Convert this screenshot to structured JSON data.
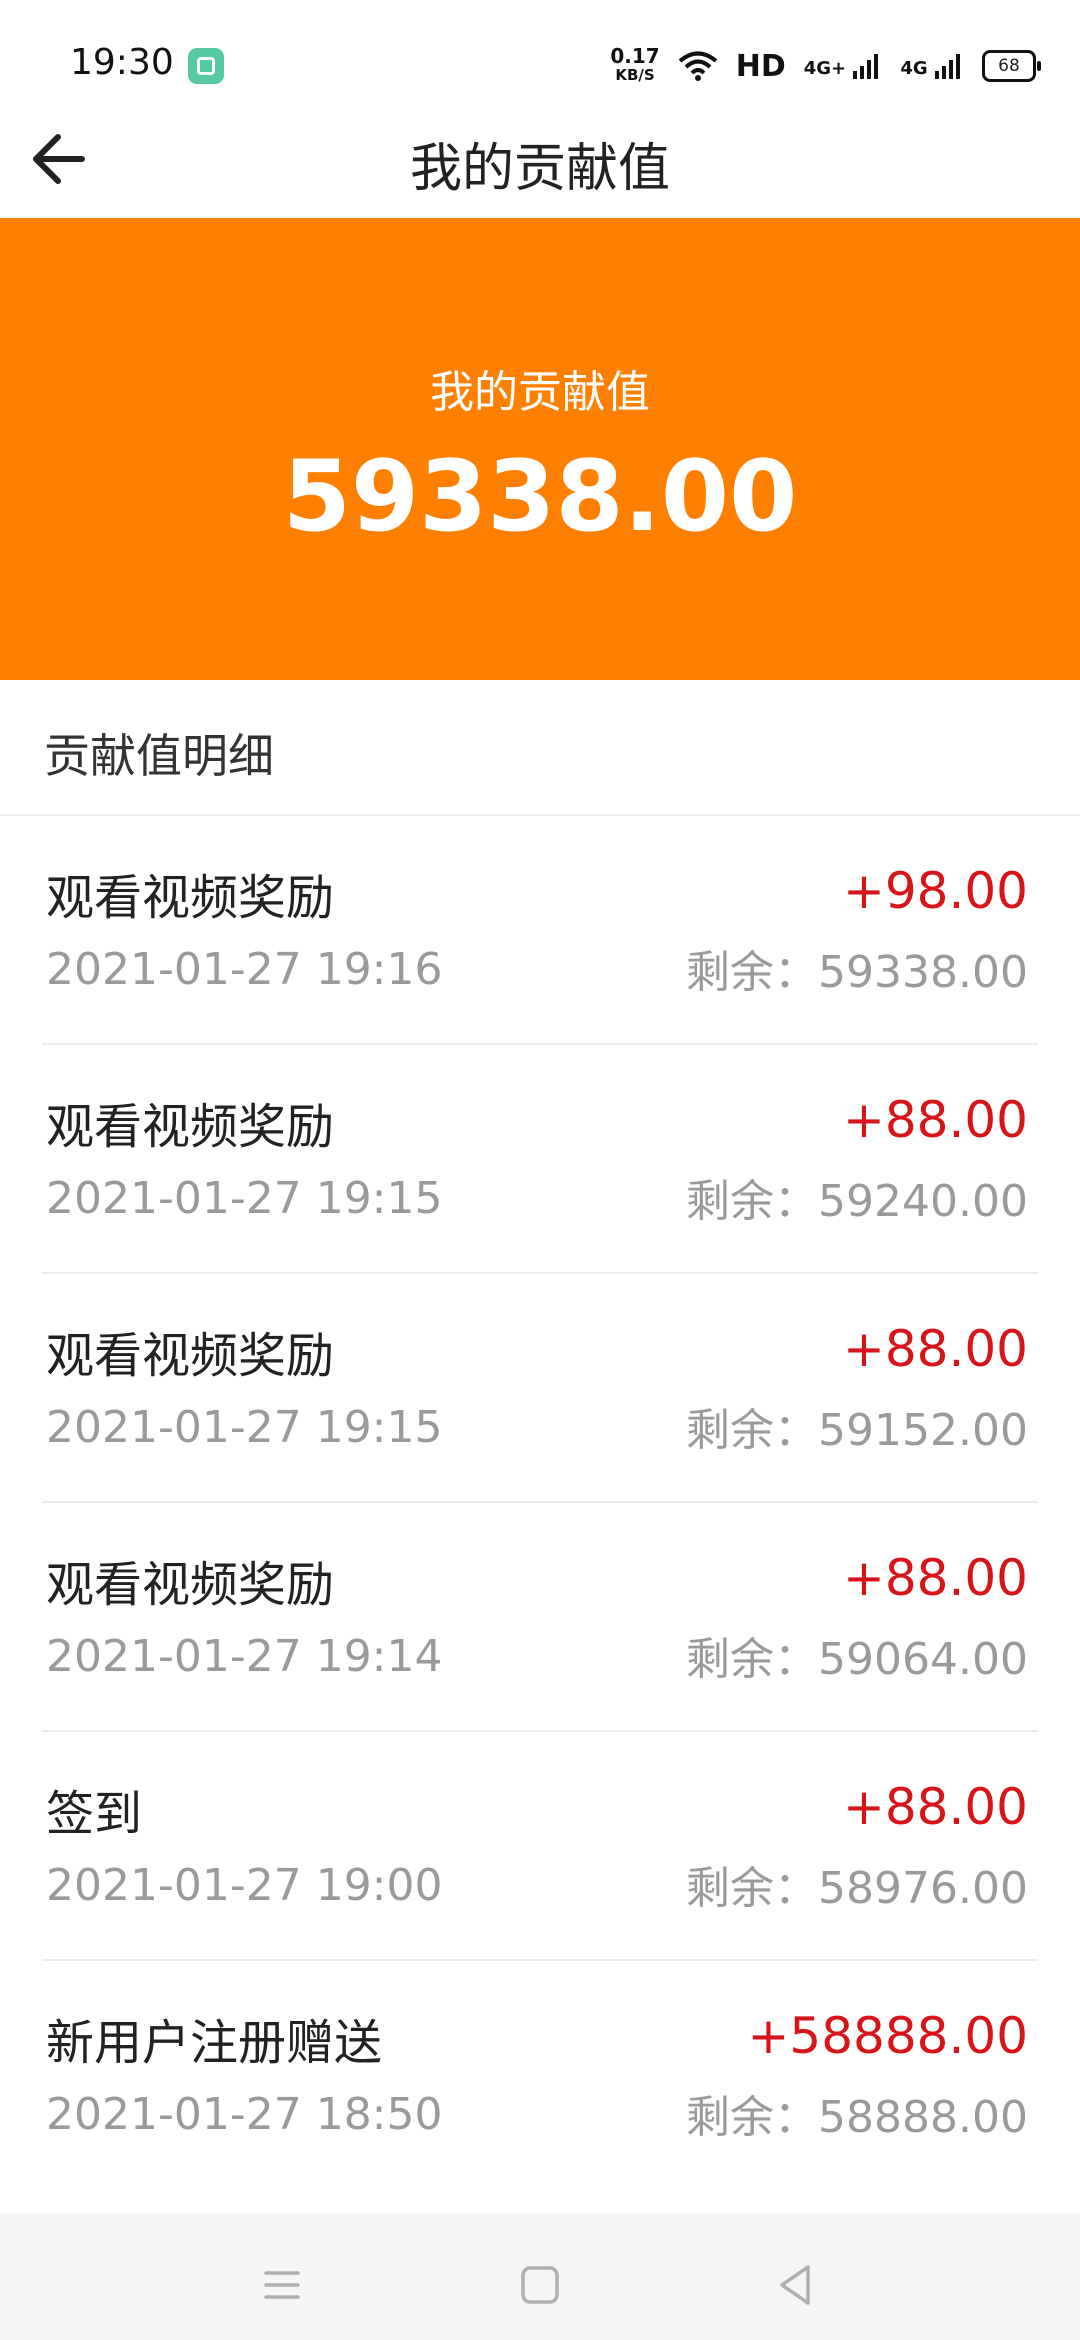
{
  "status_bar": {
    "time": "19:30",
    "speed_value": "0.17",
    "speed_unit": "KB/S",
    "hd": "HD",
    "net1": "4G+",
    "net2": "4G",
    "battery": "68"
  },
  "header": {
    "title": "我的贡献值",
    "back_icon": "arrow-left-icon"
  },
  "banner": {
    "label": "我的贡献值",
    "value": "59338.00",
    "color": "#ff7f00"
  },
  "section": {
    "title": "贡献值明细"
  },
  "records": [
    {
      "title": "观看视频奖励",
      "time": "2021-01-27 19:16",
      "amount": "+98.00",
      "balance": "剩余：59338.00"
    },
    {
      "title": "观看视频奖励",
      "time": "2021-01-27 19:15",
      "amount": "+88.00",
      "balance": "剩余：59240.00"
    },
    {
      "title": "观看视频奖励",
      "time": "2021-01-27 19:15",
      "amount": "+88.00",
      "balance": "剩余：59152.00"
    },
    {
      "title": "观看视频奖励",
      "time": "2021-01-27 19:14",
      "amount": "+88.00",
      "balance": "剩余：59064.00"
    },
    {
      "title": "签到",
      "time": "2021-01-27 19:00",
      "amount": "+88.00",
      "balance": "剩余：58976.00"
    },
    {
      "title": "新用户注册赠送",
      "time": "2021-01-27 18:50",
      "amount": "+58888.00",
      "balance": "剩余：58888.00"
    }
  ],
  "nav": {
    "menu_icon": "menu-icon",
    "home_icon": "home-square-icon",
    "back_icon": "back-triangle-icon"
  },
  "colors": {
    "accent": "#ff7f00",
    "amount": "#d7141a",
    "muted": "#9a9a9a"
  }
}
